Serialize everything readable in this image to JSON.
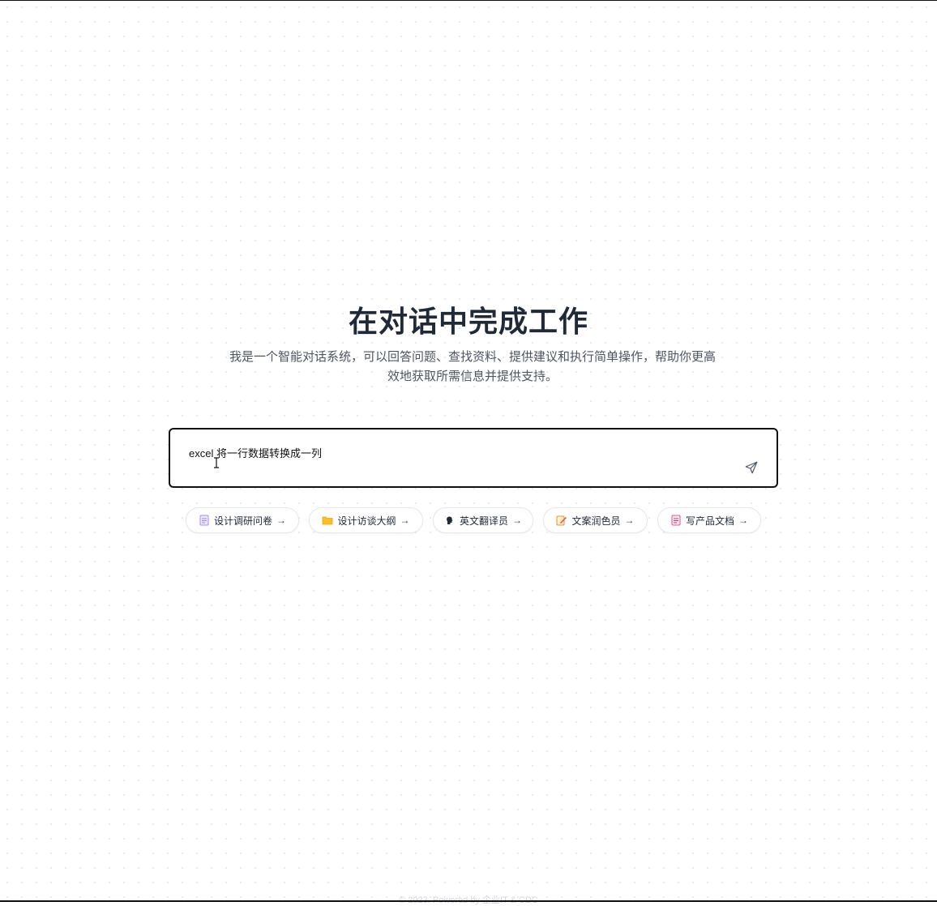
{
  "hero": {
    "title": "在对话中完成工作",
    "subtitle": "我是一个智能对话系统，可以回答问题、查找资料、提供建议和执行简单操作，帮助你更高效地获取所需信息并提供支持。"
  },
  "chat": {
    "input_value": "excel 将一行数据转换成一列",
    "send_icon": "send-icon"
  },
  "suggestions": [
    {
      "label": "设计调研问卷",
      "icon": "document-icon",
      "arrow": "→"
    },
    {
      "label": "设计访谈大纲",
      "icon": "folder-icon",
      "arrow": "→"
    },
    {
      "label": "英文翻译员",
      "icon": "speaking-head-icon",
      "arrow": "→"
    },
    {
      "label": "文案润色员",
      "icon": "memo-pencil-icon",
      "arrow": "→"
    },
    {
      "label": "写产品文档",
      "icon": "page-icon",
      "arrow": "→"
    }
  ],
  "footer": {
    "text": "© 2023. Powered by 企业IT & CDC"
  }
}
